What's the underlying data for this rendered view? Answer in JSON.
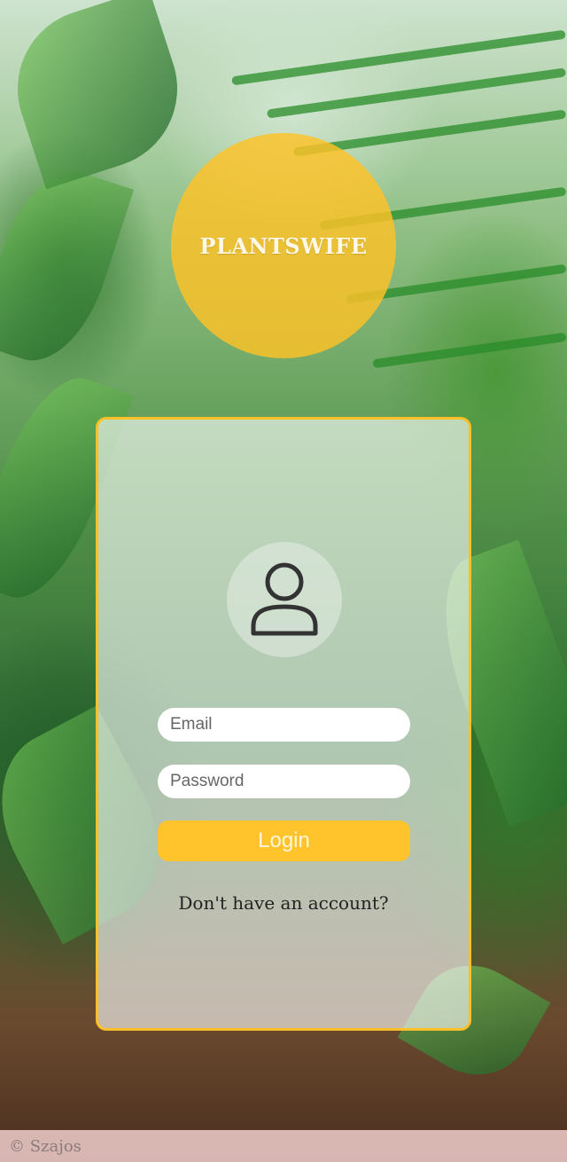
{
  "brand": {
    "name": "PLANTSWIFE"
  },
  "login": {
    "avatar_icon": "user-icon",
    "email_placeholder": "Email",
    "password_placeholder": "Password",
    "login_label": "Login",
    "signup_text": "Don't have an account?"
  },
  "footer": {
    "credit": "© Szajos"
  },
  "colors": {
    "accent": "#ffc32b",
    "card_border": "#ffc027"
  }
}
